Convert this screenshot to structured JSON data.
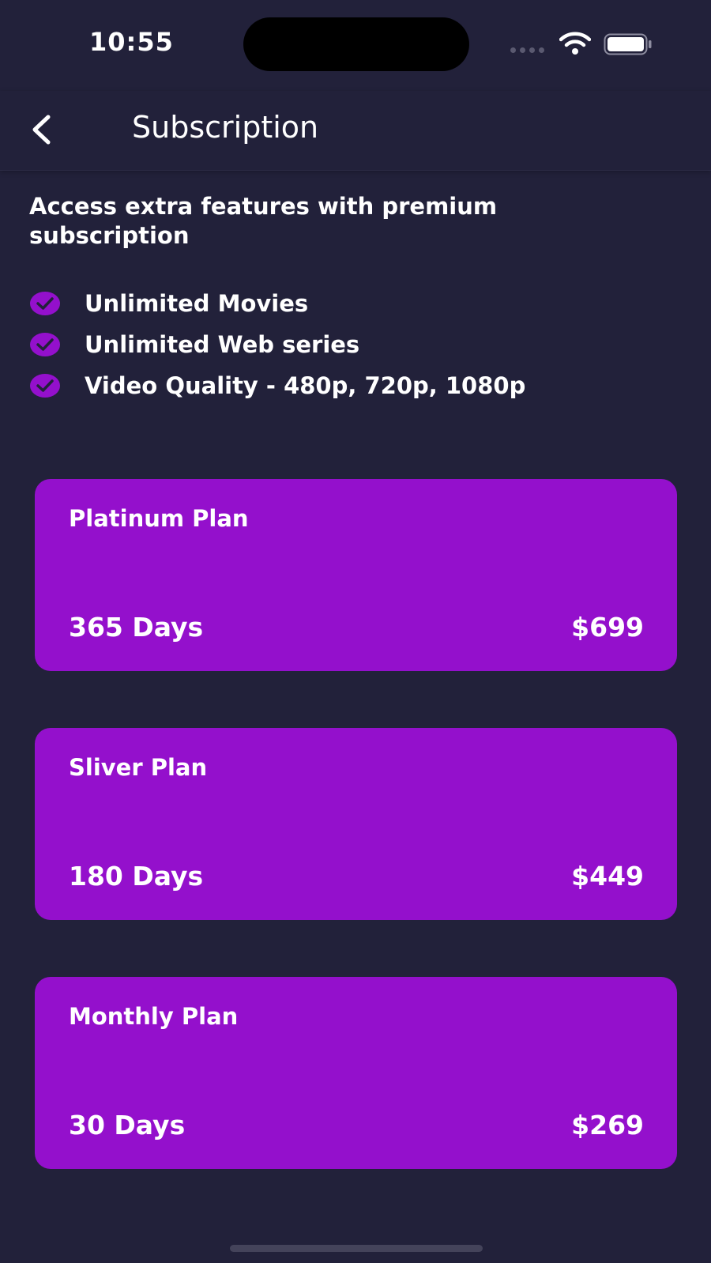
{
  "status_bar": {
    "time": "10:55"
  },
  "nav": {
    "title": "Subscription"
  },
  "intro": {
    "text": "Access extra features with premium subscription"
  },
  "features": [
    {
      "label": "Unlimited Movies",
      "icon": "check-circle-icon"
    },
    {
      "label": "Unlimited Web series",
      "icon": "check-circle-icon"
    },
    {
      "label": "Video Quality - 480p, 720p, 1080p",
      "icon": "check-circle-icon"
    }
  ],
  "plans": [
    {
      "name": "Platinum Plan",
      "duration": "365 Days",
      "price": "$699"
    },
    {
      "name": "Sliver Plan",
      "duration": "180 Days",
      "price": "$449"
    },
    {
      "name": "Monthly Plan",
      "duration": "30 Days",
      "price": "$269"
    }
  ],
  "colors": {
    "background": "#22213a",
    "card": "#9410cc",
    "check": "#9410cc",
    "text": "#ffffff"
  }
}
